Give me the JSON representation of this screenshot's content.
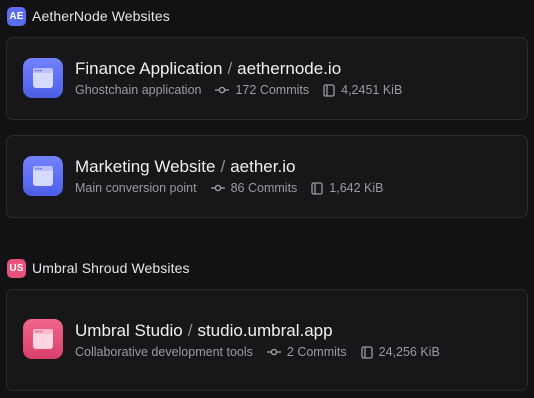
{
  "colors": {
    "background": "#121214",
    "card": "#171719",
    "card_border": "#2c2c30",
    "aether_accent": "#5b6cf0",
    "umbral_accent": "#e8527a"
  },
  "groups": [
    {
      "badge": "AE",
      "name": "AetherNode Websites",
      "accent": "#5b6cf0",
      "sites": [
        {
          "name": "Finance Application",
          "domain": "aethernode.io",
          "description": "Ghostchain application",
          "commits": "172 Commits",
          "size": "4,2451 KiB",
          "icon": "browser-window-icon"
        },
        {
          "name": "Marketing Website",
          "domain": "aether.io",
          "description": "Main conversion point",
          "commits": "86 Commits",
          "size": "1,642 KiB",
          "icon": "browser-window-icon"
        }
      ]
    },
    {
      "badge": "US",
      "name": "Umbral Shroud Websites",
      "accent": "#e8527a",
      "sites": [
        {
          "name": "Umbral Studio",
          "domain": "studio.umbral.app",
          "description": "Collaborative development tools",
          "commits": "2 Commits",
          "size": "24,256 KiB",
          "icon": "browser-window-icon"
        }
      ]
    }
  ],
  "separator": "/"
}
